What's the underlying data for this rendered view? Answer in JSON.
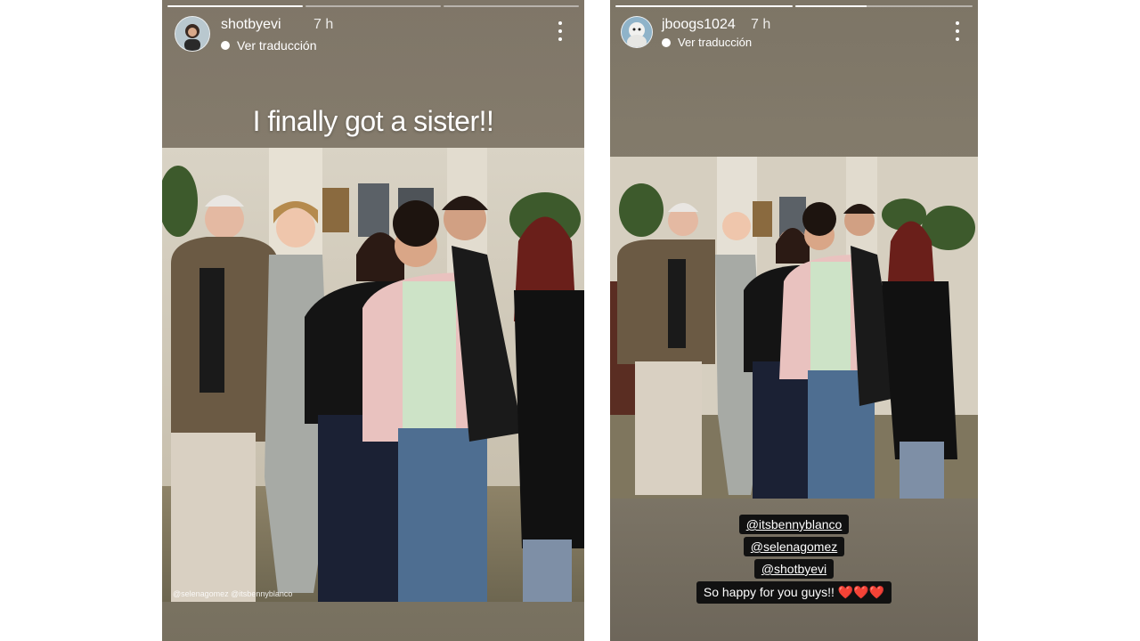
{
  "left_story": {
    "username": "shotbyevi",
    "time": "7 h",
    "translate_label": "Ver traducción",
    "caption": "I finally got a sister!!",
    "photo_tag": "@selenagomez @itsbennyblanco",
    "progress": [
      1,
      0,
      0
    ]
  },
  "right_story": {
    "username": "jboogs1024",
    "time": "7 h",
    "translate_label": "Ver traducción",
    "mentions": [
      "@itsbennyblanco",
      "@selenagomez",
      "@shotbyevi"
    ],
    "note": "So happy for you guys!! ❤️❤️❤️",
    "progress": [
      1,
      0.4
    ]
  },
  "colors": {
    "story_bg": "#857c6c",
    "tag_bg": "#111111",
    "text": "#ffffff"
  },
  "icons": {
    "more": "more-vertical-icon",
    "translate": "translate-icon"
  }
}
